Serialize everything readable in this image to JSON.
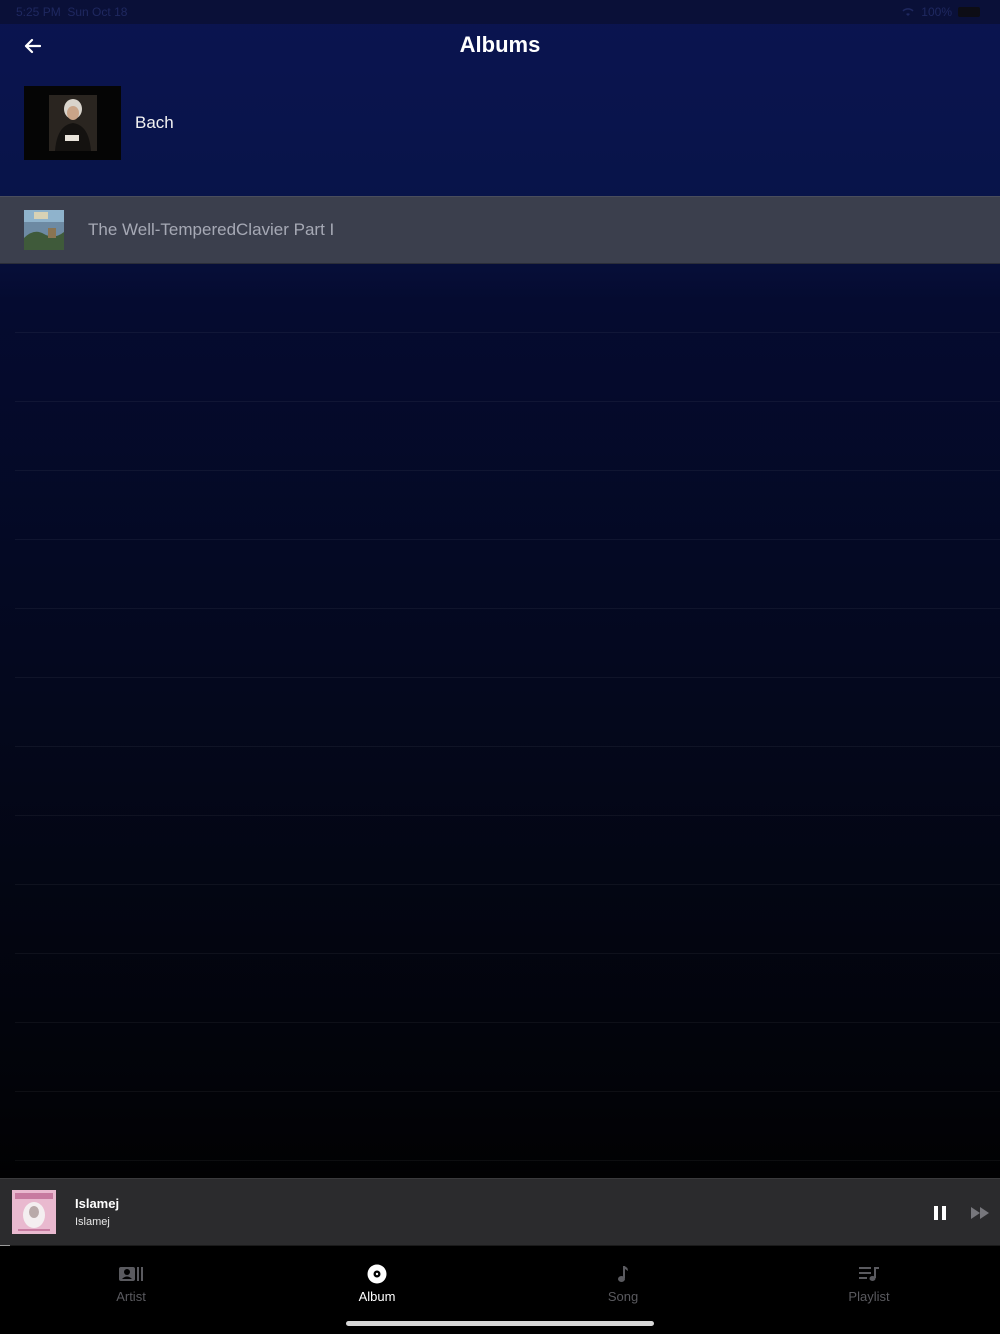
{
  "status_bar": {
    "time": "5:25 PM",
    "date": "Sun Oct 18",
    "battery": "100%"
  },
  "header": {
    "title": "Albums",
    "back_icon": "arrow-left-icon"
  },
  "artist": {
    "name": "Bach"
  },
  "albums": [
    {
      "title": "The Well-TemperedClavier Part I"
    }
  ],
  "now_playing": {
    "title": "Islamej",
    "subtitle": "Islamej",
    "progress": 0.01
  },
  "tabs": [
    {
      "label": "Artist",
      "icon": "artist-icon",
      "active": false
    },
    {
      "label": "Album",
      "icon": "album-disc-icon",
      "active": true
    },
    {
      "label": "Song",
      "icon": "music-note-icon",
      "active": false
    },
    {
      "label": "Playlist",
      "icon": "playlist-icon",
      "active": false
    }
  ],
  "colors": {
    "accent": "#ffffff",
    "inactive_tab": "#5a5a5f",
    "selected_row": "#3b3f4d",
    "mini_player": "#2b2b2d"
  }
}
